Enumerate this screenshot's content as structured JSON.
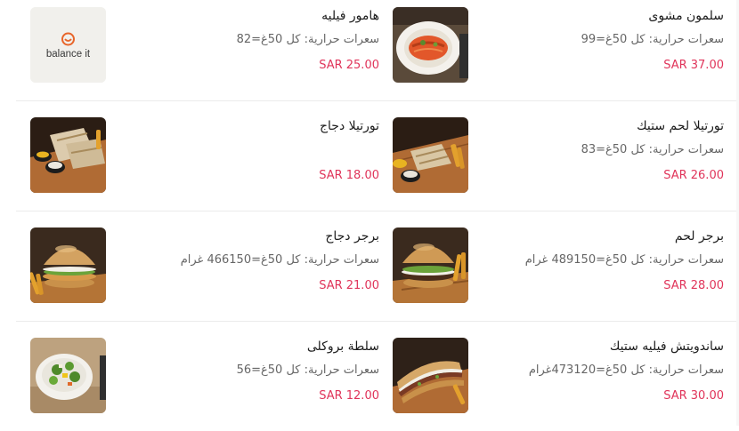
{
  "rows": [
    {
      "right": {
        "name": "سلمون مشوى",
        "calories": "سعرات حرارية: كل 50غ=99",
        "price": "SAR 37.00",
        "image": "grilled-salmon-photo"
      },
      "left": {
        "name": "هامور فيليه",
        "calories": "سعرات حرارية: كل 50غ=82",
        "price": "SAR 25.00",
        "image": "balance-it-logo",
        "logo_text": "balance it"
      }
    },
    {
      "right": {
        "name": "تورتيلا لحم ستيك",
        "calories": "سعرات حرارية: كل 50غ=83",
        "price": "SAR 26.00",
        "image": "steak-tortilla-photo"
      },
      "left": {
        "name": "تورتيلا دجاج",
        "calories": "",
        "price": "SAR 18.00",
        "image": "chicken-tortilla-photo"
      }
    },
    {
      "right": {
        "name": "برجر لحم",
        "calories": "سعرات حرارية: كل 50غ=489150 غرام",
        "price": "SAR 28.00",
        "image": "beef-burger-photo"
      },
      "left": {
        "name": "برجر دجاج",
        "calories": "سعرات حرارية: كل 50غ=466150 غرام",
        "price": "SAR 21.00",
        "image": "chicken-burger-photo"
      }
    },
    {
      "right": {
        "name": "ساندويتش فيليه ستيك",
        "calories": "سعرات حرارية: كل 50غ=473120غرام",
        "price": "SAR 30.00",
        "image": "steak-sandwich-photo"
      },
      "left": {
        "name": "سلطة بروكلى",
        "calories": "سعرات حرارية: كل 50غ=56",
        "price": "SAR 12.00",
        "image": "broccoli-salad-photo"
      }
    }
  ],
  "colors": {
    "price": "#e0345a",
    "calories": "#666666",
    "name": "#1c1c1c",
    "divider": "#ebebeb",
    "logo_accent": "#e8652a"
  }
}
